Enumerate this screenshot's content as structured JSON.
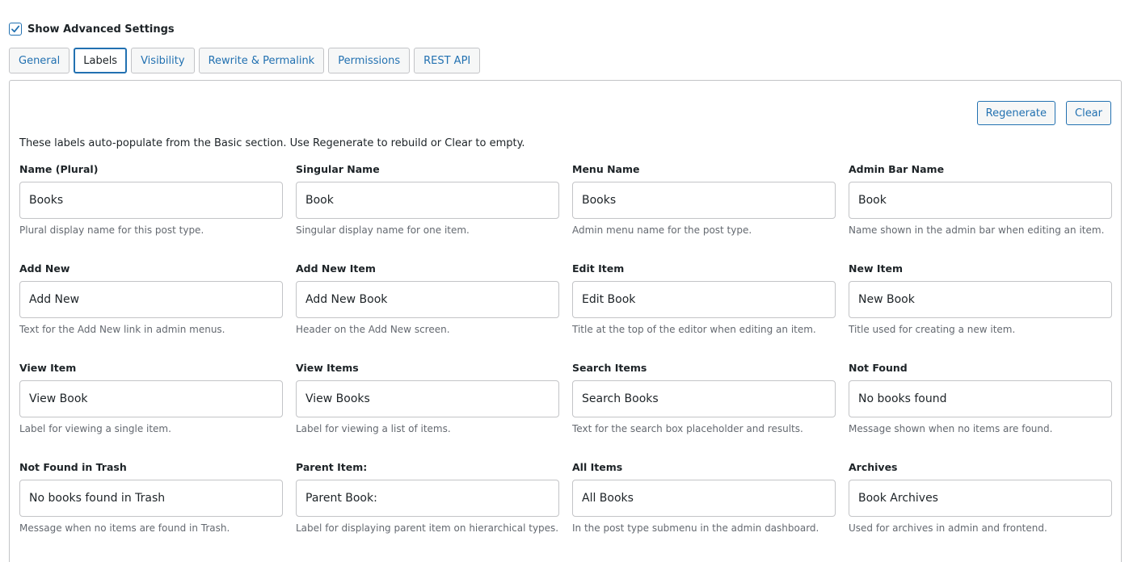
{
  "advanced": {
    "label": "Show Advanced Settings",
    "checked": true
  },
  "tabs": [
    {
      "label": "General",
      "active": false
    },
    {
      "label": "Labels",
      "active": true
    },
    {
      "label": "Visibility",
      "active": false
    },
    {
      "label": "Rewrite & Permalink",
      "active": false
    },
    {
      "label": "Permissions",
      "active": false
    },
    {
      "label": "REST API",
      "active": false
    }
  ],
  "actions": {
    "regenerate_label": "Regenerate",
    "clear_label": "Clear"
  },
  "intro": "These labels auto-populate from the Basic section. Use Regenerate to rebuild or Clear to empty.",
  "fields": [
    {
      "label": "Name (Plural)",
      "value": "Books",
      "help": "Plural display name for this post type."
    },
    {
      "label": "Singular Name",
      "value": "Book",
      "help": "Singular display name for one item."
    },
    {
      "label": "Menu Name",
      "value": "Books",
      "help": "Admin menu name for the post type."
    },
    {
      "label": "Admin Bar Name",
      "value": "Book",
      "help": "Name shown in the admin bar when editing an item."
    },
    {
      "label": "Add New",
      "value": "Add New",
      "help": "Text for the Add New link in admin menus."
    },
    {
      "label": "Add New Item",
      "value": "Add New Book",
      "help": "Header on the Add New screen."
    },
    {
      "label": "Edit Item",
      "value": "Edit Book",
      "help": "Title at the top of the editor when editing an item."
    },
    {
      "label": "New Item",
      "value": "New Book",
      "help": "Title used for creating a new item."
    },
    {
      "label": "View Item",
      "value": "View Book",
      "help": "Label for viewing a single item."
    },
    {
      "label": "View Items",
      "value": "View Books",
      "help": "Label for viewing a list of items."
    },
    {
      "label": "Search Items",
      "value": "Search Books",
      "help": "Text for the search box placeholder and results."
    },
    {
      "label": "Not Found",
      "value": "No books found",
      "help": "Message shown when no items are found."
    },
    {
      "label": "Not Found in Trash",
      "value": "No books found in Trash",
      "help": "Message when no items are found in Trash."
    },
    {
      "label": "Parent Item:",
      "value": "Parent Book:",
      "help": "Label for displaying parent item on hierarchical types."
    },
    {
      "label": "All Items",
      "value": "All Books",
      "help": "In the post type submenu in the admin dashboard."
    },
    {
      "label": "Archives",
      "value": "Book Archives",
      "help": "Used for archives in admin and frontend."
    }
  ],
  "colors": {
    "accent": "#2271b1",
    "border": "#c3c4c7",
    "help_text": "#646970"
  }
}
